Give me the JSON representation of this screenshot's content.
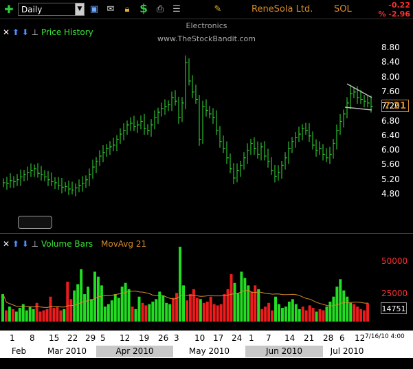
{
  "toolbar": {
    "period": "Daily",
    "icons": [
      "add-icon",
      "save-icon",
      "mail-icon",
      "lock-icon",
      "dollar-icon",
      "print-icon",
      "list-icon",
      "pencil-icon"
    ],
    "company": "ReneSola Ltd.",
    "ticker": "SOL",
    "change": "-0.22",
    "change_pct": "% -2.96"
  },
  "price_panel": {
    "title": "Price History",
    "sector": "Electronics",
    "website": "www.TheStockBandit.com",
    "last_price": "7.21",
    "y_ticks": [
      "8.80",
      "8.40",
      "8.00",
      "7.60",
      "7.20",
      "6.80",
      "6.40",
      "6.00",
      "5.60",
      "5.20",
      "4.80"
    ]
  },
  "volume_panel": {
    "title": "Volume Bars",
    "ma_label": "MovAvg 21",
    "y_ticks": [
      "50000",
      "25000"
    ],
    "last_volume": "14751"
  },
  "x_axis": {
    "days": [
      "1",
      "8",
      "15",
      "22",
      "29",
      "5",
      "12",
      "19",
      "26",
      "3",
      "10",
      "17",
      "24",
      "1",
      "7",
      "14",
      "21",
      "28",
      "6",
      "12"
    ],
    "timestamp": "7/16/10 4:00",
    "months": [
      "Feb 2010",
      "Mar 2010",
      "Apr 2010",
      "May 2010",
      "Jun 2010",
      "Jul 2010"
    ]
  },
  "chart_data": {
    "type": "bar",
    "price_bars_close": [
      5.12,
      5.1,
      5.18,
      5.15,
      5.2,
      5.28,
      5.35,
      5.4,
      5.45,
      5.5,
      5.38,
      5.35,
      5.28,
      5.2,
      5.15,
      5.12,
      5.05,
      5.0,
      5.02,
      4.95,
      4.92,
      4.98,
      5.05,
      5.1,
      5.2,
      5.35,
      5.55,
      5.7,
      5.85,
      5.95,
      6.05,
      6.1,
      6.15,
      6.3,
      6.45,
      6.55,
      6.7,
      6.75,
      6.65,
      6.7,
      6.8,
      6.6,
      6.55,
      6.7,
      6.9,
      7.05,
      7.15,
      7.2,
      7.25,
      7.45,
      7.35,
      6.9,
      7.3,
      8.4,
      7.9,
      7.6,
      7.4,
      6.3,
      7.2,
      7.1,
      7.0,
      6.9,
      6.55,
      6.25,
      6.05,
      5.8,
      5.5,
      5.25,
      5.45,
      5.6,
      5.8,
      6.0,
      6.2,
      6.05,
      5.9,
      6.1,
      5.85,
      5.7,
      5.45,
      5.3,
      5.4,
      5.6,
      5.8,
      6.05,
      6.25,
      6.35,
      6.45,
      6.6,
      6.55,
      6.4,
      6.15,
      6.0,
      6.05,
      5.9,
      5.8,
      5.9,
      6.2,
      6.55,
      6.8,
      7.0,
      7.3,
      7.55,
      7.6,
      7.45,
      7.4,
      7.35,
      7.3,
      7.21
    ],
    "volume": [
      22000,
      9000,
      12000,
      10000,
      8000,
      11000,
      14000,
      9000,
      12000,
      10000,
      15000,
      8000,
      9000,
      10000,
      20000,
      11000,
      12000,
      9000,
      10000,
      32000,
      18000,
      25000,
      30000,
      42000,
      22000,
      28000,
      18000,
      40000,
      36000,
      29000,
      12000,
      14000,
      17000,
      22000,
      19000,
      28000,
      31000,
      26000,
      12000,
      10000,
      20000,
      15000,
      13000,
      14000,
      16000,
      18000,
      24000,
      21000,
      15000,
      14000,
      19000,
      23000,
      60000,
      29000,
      17000,
      22000,
      26000,
      19000,
      18000,
      15000,
      16000,
      20000,
      14000,
      13000,
      14000,
      22000,
      26000,
      38000,
      31000,
      23000,
      40000,
      35000,
      29000,
      24000,
      29000,
      26000,
      10000,
      12000,
      15000,
      9000,
      20000,
      14000,
      11000,
      12000,
      16000,
      18000,
      14000,
      10000,
      12000,
      9000,
      13000,
      11000,
      8000,
      10000,
      9000,
      12000,
      16000,
      20000,
      28000,
      34000,
      25000,
      20000,
      15000,
      14000,
      12000,
      10000,
      9000,
      14751
    ],
    "ylim_price": [
      4.6,
      9.0
    ],
    "ylim_volume": [
      0,
      65000
    ]
  }
}
